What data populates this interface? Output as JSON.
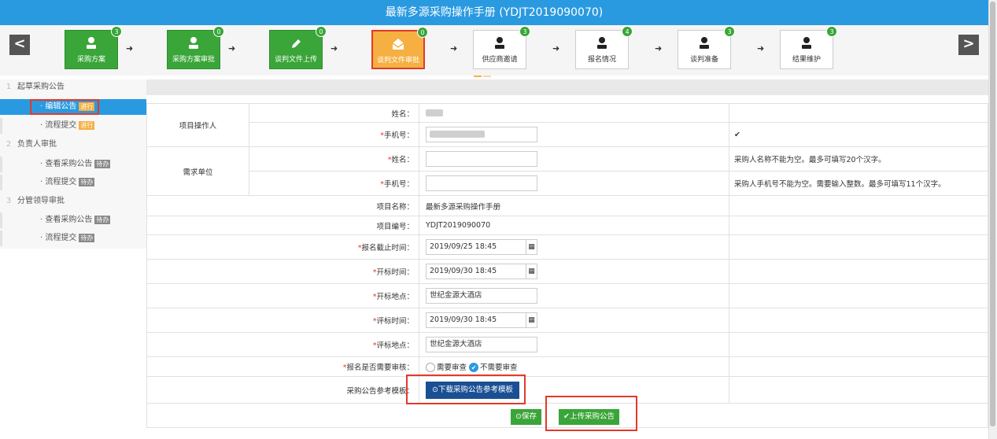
{
  "window": {
    "title": "最新多源采购操作手册 (YDJT2019090070)"
  },
  "nav": {
    "prev": "<",
    "next": ">"
  },
  "steps": [
    {
      "label": "采购方案",
      "badge": "3",
      "state": "done",
      "icon": "user-icon"
    },
    {
      "label": "采购方案审批",
      "badge": "0",
      "state": "done",
      "icon": "user-icon"
    },
    {
      "label": "谈判文件上传",
      "badge": "0",
      "state": "done",
      "icon": "pencil-icon"
    },
    {
      "label": "谈判文件审批",
      "badge": "0",
      "state": "current",
      "icon": "envelope-icon"
    },
    {
      "label": "供应商邀请",
      "badge": "3",
      "state": "todo",
      "icon": "user-icon"
    },
    {
      "label": "报名情况",
      "badge": "4",
      "state": "todo",
      "icon": "user-icon"
    },
    {
      "label": "谈判准备",
      "badge": "3",
      "state": "todo",
      "icon": "user-icon"
    },
    {
      "label": "结果维护",
      "badge": "3",
      "state": "todo",
      "icon": "user-icon"
    }
  ],
  "sidebar": {
    "groups": [
      {
        "num": "1",
        "title": "起草采购公告"
      },
      {
        "num": "2",
        "title": "负责人审批"
      },
      {
        "num": "3",
        "title": "分管领导审批"
      }
    ],
    "items": [
      {
        "label": "· 编辑公告",
        "tag": "进行",
        "active": true
      },
      {
        "label": "· 流程提交",
        "tag": "进行"
      },
      {
        "label": "· 查看采购公告",
        "tag": "待办"
      },
      {
        "label": "· 流程提交",
        "tag": "待办"
      },
      {
        "label": "· 查看采购公告",
        "tag": "待办"
      },
      {
        "label": "· 流程提交",
        "tag": "待办"
      }
    ]
  },
  "form": {
    "operator_group": "项目操作人",
    "demand_group": "需求单位",
    "labels": {
      "name": "姓名：",
      "phone": "手机号：",
      "project_name": "项目名称：",
      "project_no": "项目编号：",
      "signup_deadline": "报名截止时间：",
      "bid_open_time": "开标时间：",
      "bid_open_place": "开标地点：",
      "eval_time": "评标时间：",
      "eval_place": "评标地点：",
      "need_review": "报名是否需要审核：",
      "template": "采购公告参考模板："
    },
    "required_mark": "*",
    "checkmark": "✔",
    "tips": {
      "demand_name": "采购人名称不能为空。最多可填写20个汉字。",
      "demand_phone": "采购人手机号不能为空。需要输入整数。最多可填写11个汉字。"
    },
    "values": {
      "project_name": "最新多源采购操作手册",
      "project_no": "YDJT2019090070",
      "signup_deadline": "2019/09/25 18:45",
      "bid_open_time": "2019/09/30 18:45",
      "bid_open_place": "世纪金源大酒店",
      "eval_time": "2019/09/30 18:45",
      "eval_place": "世纪金源大酒店"
    },
    "review_options": {
      "yes": "需要审查",
      "no": "不需要审查",
      "selected": "no"
    },
    "download_button": "⊙下载采购公告参考模板"
  },
  "footer": {
    "save": "⊙保存",
    "upload": "✔上传采购公告"
  }
}
